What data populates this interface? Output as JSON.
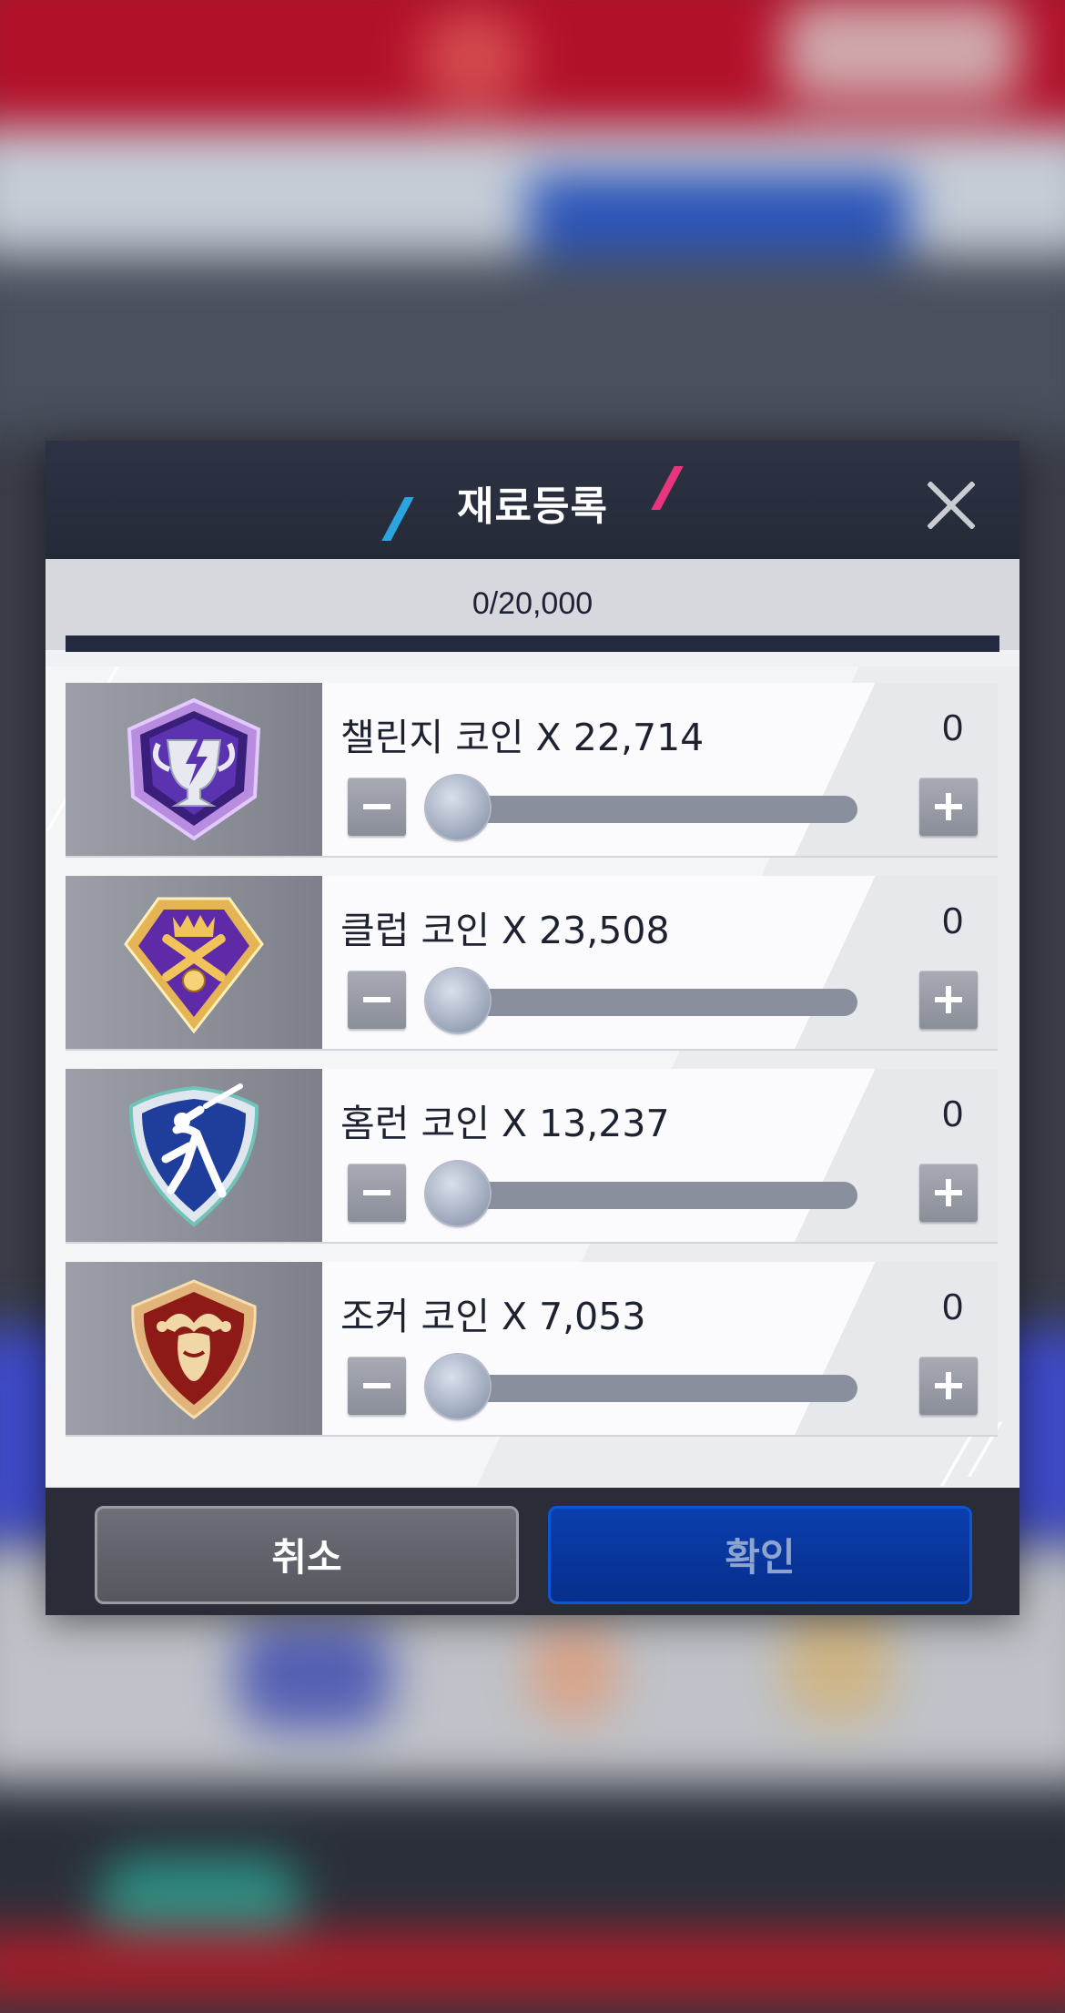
{
  "dialog": {
    "title": "재료등록",
    "progress": {
      "text": "0/20,000",
      "value": 0,
      "max": 20000
    },
    "items": [
      {
        "label": "챌린지 코인 X 22,714",
        "count": "0",
        "icon": "challenge-coin-icon"
      },
      {
        "label": "클럽 코인 X 23,508",
        "count": "0",
        "icon": "club-coin-icon"
      },
      {
        "label": "홈런 코인 X 13,237",
        "count": "0",
        "icon": "homerun-coin-icon"
      },
      {
        "label": "조커 코인 X 7,053",
        "count": "0",
        "icon": "joker-coin-icon"
      }
    ],
    "cancel_label": "취소",
    "confirm_label": "확인"
  },
  "colors": {
    "header": "#2d3344",
    "accent_blue": "#2ba4e0",
    "accent_pink": "#e8357e",
    "confirm": "#0a3fae"
  }
}
